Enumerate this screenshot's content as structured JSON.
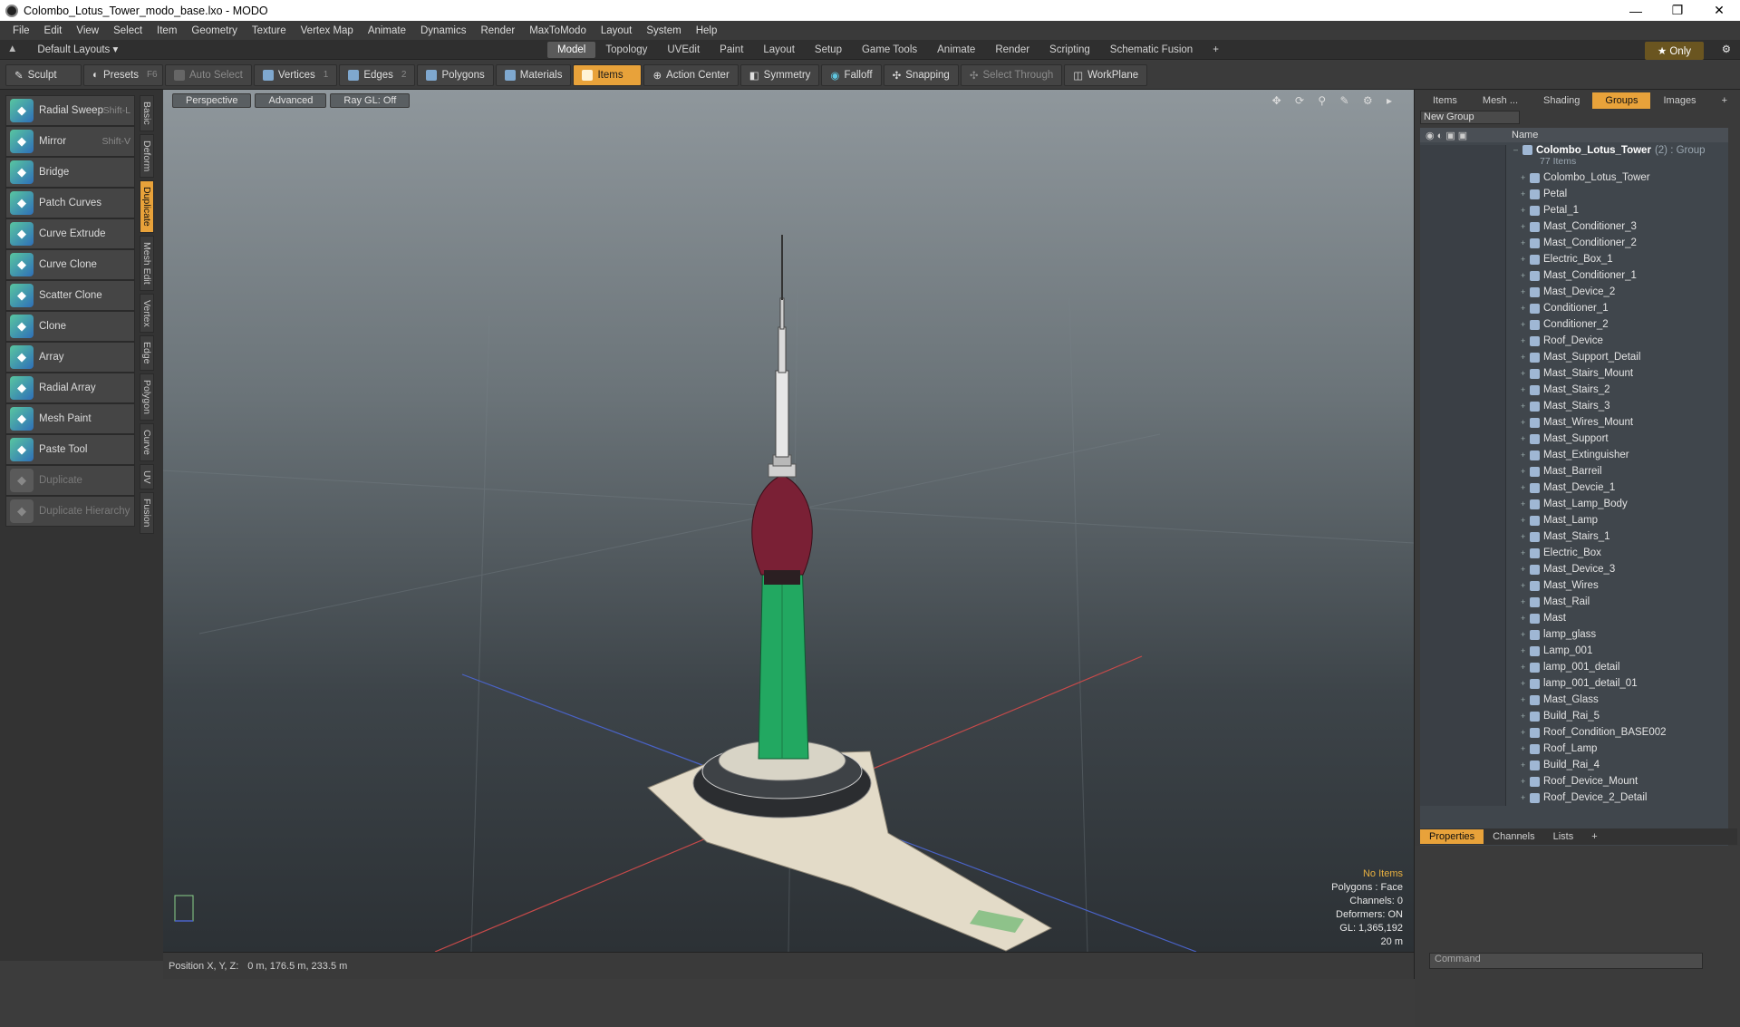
{
  "window": {
    "title": "Colombo_Lotus_Tower_modo_base.lxo - MODO",
    "min": "—",
    "max": "❐",
    "close": "✕"
  },
  "menu": [
    "File",
    "Edit",
    "View",
    "Select",
    "Item",
    "Geometry",
    "Texture",
    "Vertex Map",
    "Animate",
    "Dynamics",
    "Render",
    "MaxToModo",
    "Layout",
    "System",
    "Help"
  ],
  "layout": {
    "label": "Default Layouts ▾",
    "tabs": [
      "Model",
      "Topology",
      "UVEdit",
      "Paint",
      "Layout",
      "Setup",
      "Game Tools",
      "Animate",
      "Render",
      "Scripting",
      "Schematic Fusion",
      "+"
    ],
    "active_tab": "Model",
    "only": "★  Only"
  },
  "toolbar": {
    "sculpt": "Sculpt",
    "presets": "Presets",
    "presets_key": "F6",
    "auto_select": "Auto Select",
    "vertices": "Vertices",
    "vertices_count": "1",
    "edges": "Edges",
    "edges_count": "2",
    "polygons": "Polygons",
    "materials": "Materials",
    "items": "Items",
    "action_center": "Action Center",
    "symmetry": "Symmetry",
    "falloff": "Falloff",
    "snapping": "Snapping",
    "select_through": "Select Through",
    "workplane": "WorkPlane"
  },
  "tools": [
    {
      "label": "Radial Sweep",
      "shortcut": "Shift-L"
    },
    {
      "label": "Mirror",
      "shortcut": "Shift-V"
    },
    {
      "label": "Bridge",
      "shortcut": ""
    },
    {
      "label": "Patch Curves",
      "shortcut": ""
    },
    {
      "label": "Curve Extrude",
      "shortcut": ""
    },
    {
      "label": "Curve Clone",
      "shortcut": ""
    },
    {
      "label": "Scatter Clone",
      "shortcut": ""
    },
    {
      "label": "Clone",
      "shortcut": ""
    },
    {
      "label": "Array",
      "shortcut": ""
    },
    {
      "label": "Radial Array",
      "shortcut": ""
    },
    {
      "label": "Mesh Paint",
      "shortcut": ""
    },
    {
      "label": "Paste Tool",
      "shortcut": ""
    },
    {
      "label": "Duplicate",
      "shortcut": ""
    },
    {
      "label": "Duplicate Hierarchy",
      "shortcut": ""
    }
  ],
  "vtabs": [
    "Basic",
    "Deform",
    "Duplicate",
    "Mesh Edit",
    "Vertex",
    "Edge",
    "Polygon",
    "Curve",
    "UV",
    "Fusion"
  ],
  "viewport": {
    "perspective": "Perspective",
    "advanced": "Advanced",
    "raygl": "Ray GL: Off",
    "icons": "✥ ⟳ ⚲ ✎ ⚙ ▸",
    "stats": {
      "no_items": "No Items",
      "polygons": "Polygons : Face",
      "channels": "Channels: 0",
      "deformers": "Deformers: ON",
      "gl": "GL: 1,365,192",
      "scale": "20 m"
    }
  },
  "statusbar": {
    "label": "Position X, Y, Z:",
    "value": "0 m, 176.5 m, 233.5 m"
  },
  "right": {
    "tabs": [
      "Items",
      "Mesh ...",
      "Shading",
      "Groups",
      "Images",
      "+"
    ],
    "active_tab": "Groups",
    "new_group": "New Group",
    "name_header": "Name",
    "group_name": "Colombo_Lotus_Tower",
    "group_suffix": "(2) : Group",
    "group_count": "77 Items",
    "items": [
      "Colombo_Lotus_Tower",
      "Petal",
      "Petal_1",
      "Mast_Conditioner_3",
      "Mast_Conditioner_2",
      "Electric_Box_1",
      "Mast_Conditioner_1",
      "Mast_Device_2",
      "Conditioner_1",
      "Conditioner_2",
      "Roof_Device",
      "Mast_Support_Detail",
      "Mast_Stairs_Mount",
      "Mast_Stairs_2",
      "Mast_Stairs_3",
      "Mast_Wires_Mount",
      "Mast_Support",
      "Mast_Extinguisher",
      "Mast_Barreil",
      "Mast_Devcie_1",
      "Mast_Lamp_Body",
      "Mast_Lamp",
      "Mast_Stairs_1",
      "Electric_Box",
      "Mast_Device_3",
      "Mast_Wires",
      "Mast_Rail",
      "Mast",
      "lamp_glass",
      "Lamp_001",
      "lamp_001_detail",
      "lamp_001_detail_01",
      "Mast_Glass",
      "Build_Rai_5",
      "Roof_Condition_BASE002",
      "Roof_Lamp",
      "Build_Rai_4",
      "Roof_Device_Mount",
      "Roof_Device_2_Detail"
    ],
    "prop_tabs": [
      "Properties",
      "Channels",
      "Lists",
      "+"
    ],
    "prop_active": "Properties",
    "command_placeholder": "Command"
  }
}
